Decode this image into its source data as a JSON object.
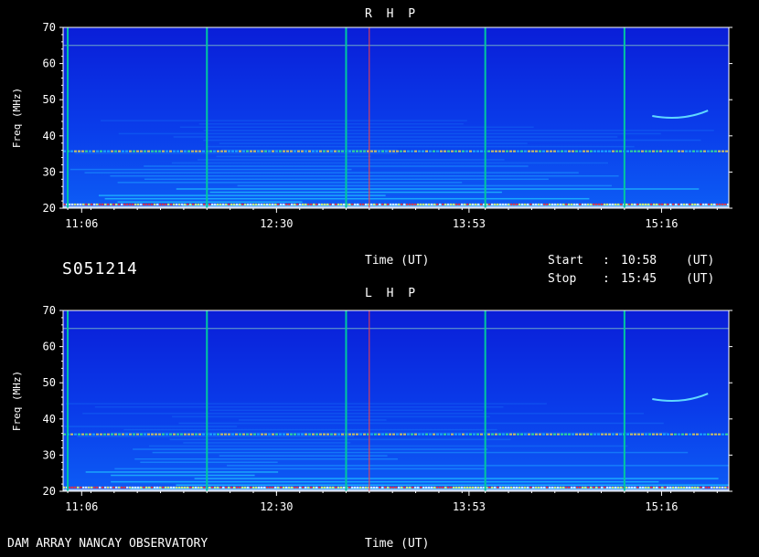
{
  "header": {
    "id_label": "S051214",
    "time_label": "Time (UT)",
    "start_label": "Start",
    "stop_label": "Stop",
    "colon": ":",
    "start_value": "10:58",
    "stop_value": "15:45",
    "ut_unit": "(UT)"
  },
  "footer": {
    "observatory": "DAM ARRAY  NANCAY OBSERVATORY",
    "time_label": "Time (UT)"
  },
  "colors": {
    "background": "#0a2be0",
    "grid": "#00c8a0",
    "marker": "#ff4040",
    "axis": "#ffffff"
  },
  "chart_data": [
    {
      "type": "heatmap",
      "title": "R H P",
      "xlabel": "Time (UT)",
      "ylabel": "Freq (MHz)",
      "xlim": [
        "10:58",
        "15:45"
      ],
      "ylim": [
        20,
        70
      ],
      "x_ticks": [
        "11:06",
        "12:30",
        "13:53",
        "15:16"
      ],
      "y_ticks": [
        20,
        30,
        40,
        50,
        60,
        70
      ],
      "vertical_lines_ut": [
        "11:00",
        "12:00",
        "13:00",
        "14:00",
        "15:00"
      ],
      "marker_line_ut": "13:10",
      "grid": true
    },
    {
      "type": "heatmap",
      "title": "L H P",
      "xlabel": "Time (UT)",
      "ylabel": "Freq (MHz)",
      "xlim": [
        "10:58",
        "15:45"
      ],
      "ylim": [
        20,
        70
      ],
      "x_ticks": [
        "11:06",
        "12:30",
        "13:53",
        "15:16"
      ],
      "y_ticks": [
        20,
        30,
        40,
        50,
        60,
        70
      ],
      "vertical_lines_ut": [
        "11:00",
        "12:00",
        "13:00",
        "14:00",
        "15:00"
      ],
      "marker_line_ut": "13:10",
      "grid": true
    }
  ]
}
